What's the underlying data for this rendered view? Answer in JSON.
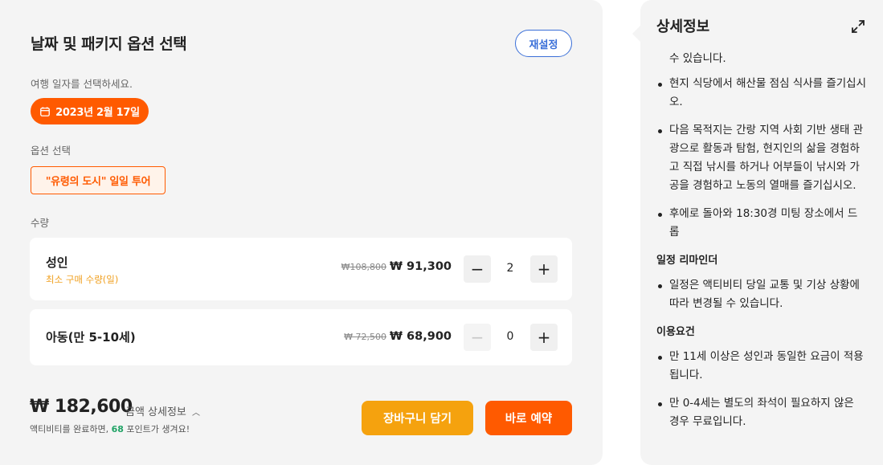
{
  "left": {
    "title": "날짜 및 패키지 옵션 선택",
    "reset_label": "재설정",
    "date_label": "여행 일자를 선택하세요.",
    "date_value": "2023년 2월 17일",
    "option_label": "옵션 선택",
    "option_value": "\"유령의 도시\" 일일 투어",
    "qty_label": "수량",
    "rows": [
      {
        "name": "성인",
        "sub": "최소 구매 수량(일)",
        "old_price": "₩108,800",
        "price": "₩ 91,300",
        "qty": "2",
        "minus_disabled": false
      },
      {
        "name": "아동(만 5-10세)",
        "sub": "",
        "old_price": "₩ 72,500",
        "price": "₩ 68,900",
        "qty": "0",
        "minus_disabled": true
      }
    ],
    "total": "₩ 182,600",
    "detail_link": "금액 상세정보",
    "points_prefix": "액티비티를 완료하면, ",
    "points_value": "68",
    "points_suffix": " 포인트가 생겨요!",
    "cart_label": "장바구니 담기",
    "book_label": "바로 예약"
  },
  "right": {
    "title": "상세정보",
    "fragment": "수 있습니다.",
    "list1": [
      "현지 식당에서 해산물 점심 식사를 즐기십시오.",
      "다음 목적지는 간랑 지역 사회 기반 생태 관광으로 활동과 탐험, 현지인의 삶을 경험하고 직접 낚시를 하거나 어부들이 낚시와 가공을 경험하고 노동의 열매를 즐기십시오.",
      "후에로 돌아와 18:30경 미팅 장소에서 드롭"
    ],
    "reminder_title": "일정 리마인더",
    "reminder_items": [
      "일정은 액티비티 당일 교통 및 기상 상황에 따라 변경될 수 있습니다."
    ],
    "req_title": "이용요건",
    "req_items": [
      "만 11세 이상은 성인과 동일한 요금이 적용됩니다.",
      "만 0-4세는 별도의 좌석이 필요하지 않은 경우 무료입니다."
    ]
  }
}
